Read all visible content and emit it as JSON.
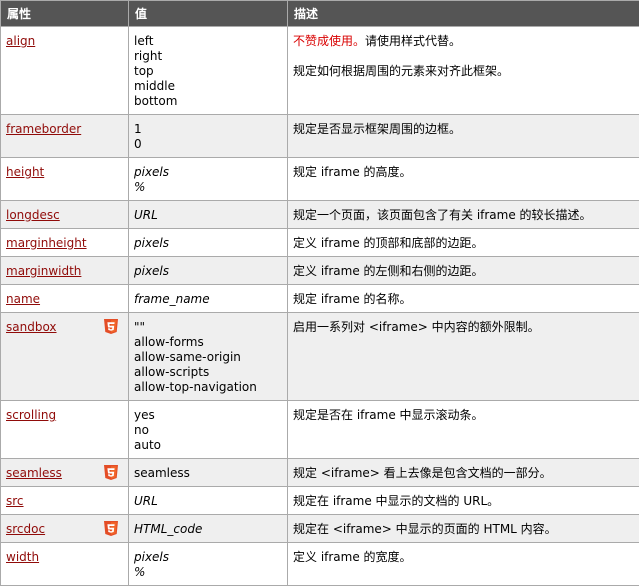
{
  "headers": [
    "属性",
    "值",
    "描述"
  ],
  "colors": {
    "header_bg": "#555555",
    "link": "#900b09",
    "deprecated": "#d90000",
    "row_alt": "#efefef"
  },
  "rows": [
    {
      "attr": "align",
      "html5": false,
      "values": [
        "left",
        "right",
        "top",
        "middle",
        "bottom"
      ],
      "italic": false,
      "desc_warning": "不赞成使用。",
      "desc_warning_suffix": "请使用样式代替。",
      "desc": "规定如何根据周围的元素来对齐此框架。"
    },
    {
      "attr": "frameborder",
      "html5": false,
      "values": [
        "1",
        "0"
      ],
      "italic": false,
      "desc": "规定是否显示框架周围的边框。"
    },
    {
      "attr": "height",
      "html5": false,
      "values": [
        "pixels",
        "%"
      ],
      "italic": true,
      "desc": "规定 iframe 的高度。"
    },
    {
      "attr": "longdesc",
      "html5": false,
      "values": [
        "URL"
      ],
      "italic": true,
      "desc": "规定一个页面，该页面包含了有关 iframe 的较长描述。"
    },
    {
      "attr": "marginheight",
      "html5": false,
      "values": [
        "pixels"
      ],
      "italic": true,
      "desc": "定义 iframe 的顶部和底部的边距。"
    },
    {
      "attr": "marginwidth",
      "html5": false,
      "values": [
        "pixels"
      ],
      "italic": true,
      "desc": "定义 iframe 的左侧和右侧的边距。"
    },
    {
      "attr": "name",
      "html5": false,
      "values": [
        "frame_name"
      ],
      "italic": true,
      "desc": "规定 iframe 的名称。"
    },
    {
      "attr": "sandbox",
      "html5": true,
      "values": [
        "\"\"",
        "allow-forms",
        "allow-same-origin",
        "allow-scripts",
        "allow-top-navigation"
      ],
      "italic": false,
      "desc": "启用一系列对 <iframe> 中内容的额外限制。"
    },
    {
      "attr": "scrolling",
      "html5": false,
      "values": [
        "yes",
        "no",
        "auto"
      ],
      "italic": false,
      "desc": "规定是否在 iframe 中显示滚动条。"
    },
    {
      "attr": "seamless",
      "html5": true,
      "values": [
        "seamless"
      ],
      "italic": false,
      "desc": "规定 <iframe> 看上去像是包含文档的一部分。"
    },
    {
      "attr": "src",
      "html5": false,
      "values": [
        "URL"
      ],
      "italic": true,
      "desc": "规定在 iframe 中显示的文档的 URL。"
    },
    {
      "attr": "srcdoc",
      "html5": true,
      "values": [
        "HTML_code"
      ],
      "italic": true,
      "desc": "规定在 <iframe> 中显示的页面的 HTML 内容。"
    },
    {
      "attr": "width",
      "html5": false,
      "values": [
        "pixels",
        "%"
      ],
      "italic": true,
      "desc": "定义 iframe 的宽度。"
    }
  ]
}
